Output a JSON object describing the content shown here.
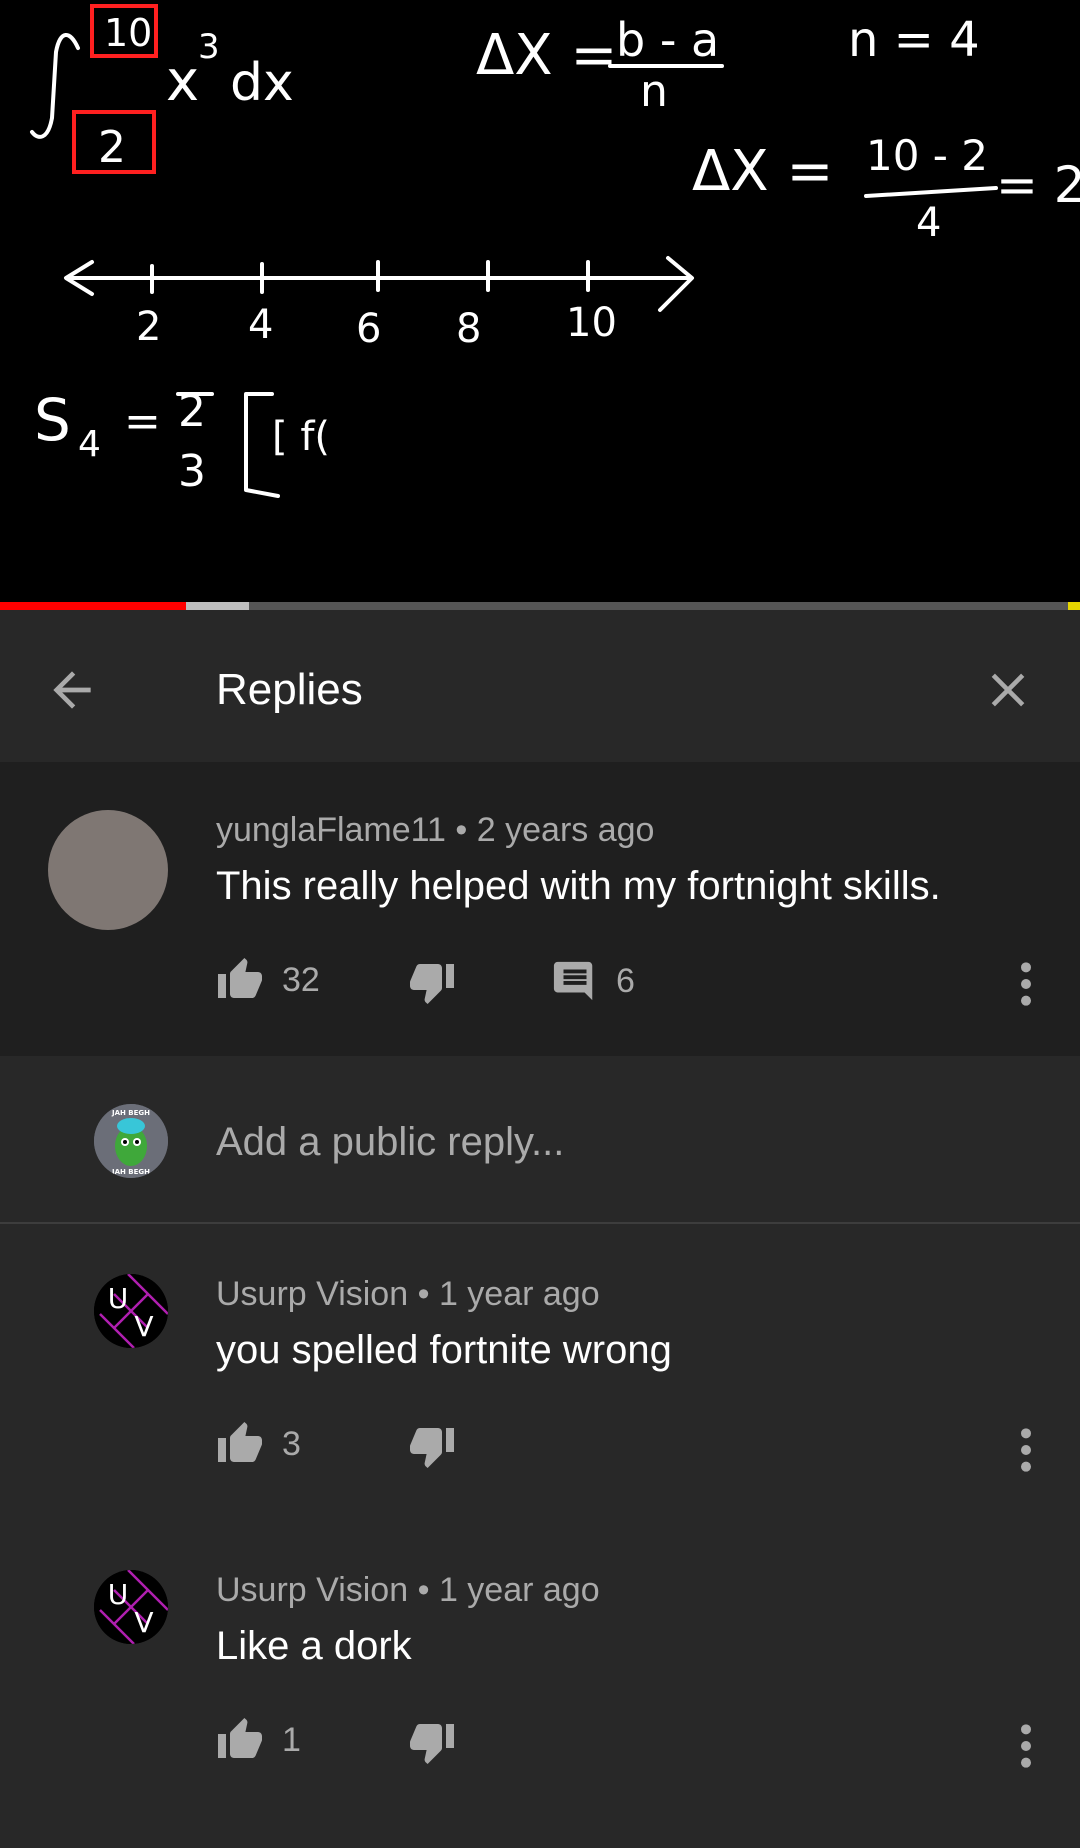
{
  "video": {
    "progress_played_fraction": 0.172,
    "progress_buffered_fraction": 0.231,
    "board": {
      "upper_limit": "10",
      "lower_limit": "2",
      "integrand": "x",
      "exponent": "3",
      "dx": "dx",
      "delta_x_formula_lhs": "ΔX =",
      "delta_x_num": "b - a",
      "delta_x_den": "n",
      "n_value": "n = 4",
      "delta_x_calc_lhs": "ΔX =",
      "delta_x_calc_num": "10 - 2",
      "delta_x_calc_den": "4",
      "delta_x_result": "= 2",
      "ticks": [
        "2",
        "4",
        "6",
        "8",
        "10"
      ],
      "s4_lhs": "S",
      "s4_sub": "4",
      "s4_eq": "=",
      "s4_frac_num": "2",
      "s4_frac_den": "3",
      "s4_bracket": "[ f("
    }
  },
  "header": {
    "title": "Replies"
  },
  "top_comment": {
    "author": "yunglaFlame11",
    "time": "2 years ago",
    "text": "This really helped with my fortnight skills.",
    "likes": "32",
    "replies": "6"
  },
  "add_reply": {
    "placeholder": "Add a public reply...",
    "avatar_text_top": "JAH BEGH",
    "avatar_text_bottom": "JAH BEGH"
  },
  "replies": [
    {
      "author": "Usurp Vision",
      "time": "1 year ago",
      "text": "you spelled fortnite wrong",
      "likes": "3",
      "avatar_letters": [
        "U",
        "V"
      ]
    },
    {
      "author": "Usurp Vision",
      "time": "1 year ago",
      "text": "Like a dork",
      "likes": "1",
      "avatar_letters": [
        "U",
        "V"
      ]
    }
  ],
  "colors": {
    "progress_played": "#ff0000",
    "progress_buffered": "#bdbdbd",
    "marker": "#e6d600",
    "board_highlight": "#ff2020",
    "background": "#282828",
    "top_comment_bg": "#1f1f1f"
  },
  "icons": {
    "back": "arrow-left-icon",
    "close": "close-icon",
    "like": "thumb-up-icon",
    "dislike": "thumb-down-icon",
    "reply": "comment-icon",
    "more": "more-vert-icon"
  }
}
